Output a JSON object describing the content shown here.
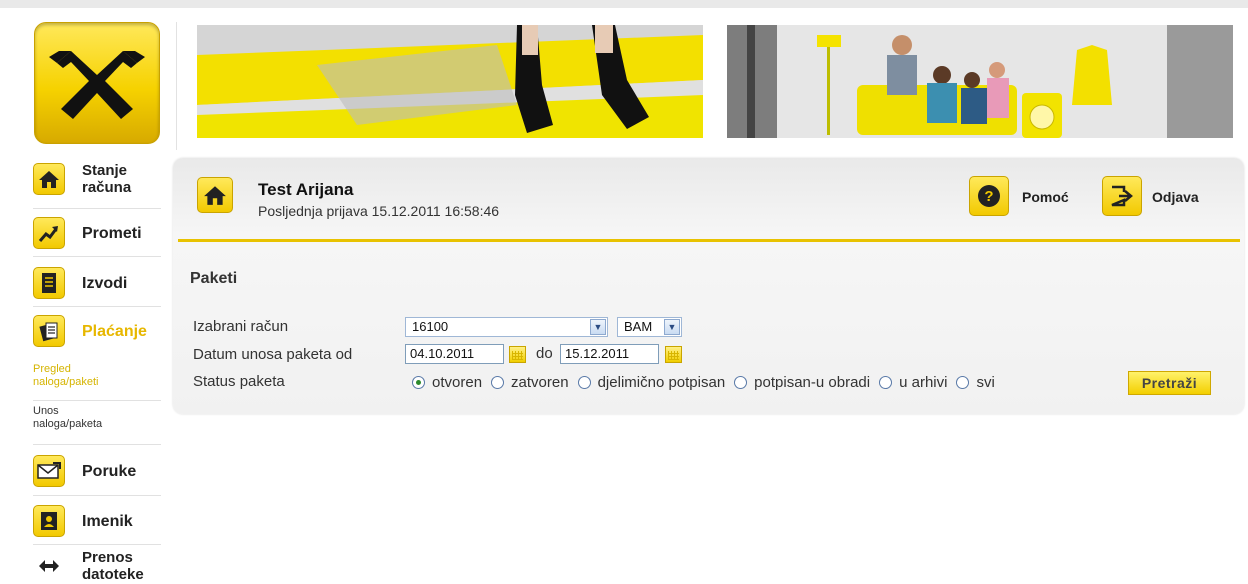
{
  "sidebar": {
    "items": [
      {
        "label": "Stanje računa",
        "line1": "Stanje",
        "line2": "računa"
      },
      {
        "label": "Prometi"
      },
      {
        "label": "Izvodi"
      },
      {
        "label": "Plaćanje"
      },
      {
        "label": "Poruke"
      },
      {
        "label": "Imenik"
      },
      {
        "label": "Prenos datoteke",
        "line1": "Prenos",
        "line2": "datoteke"
      }
    ],
    "subitems": [
      {
        "line1": "Pregled",
        "line2": "naloga/paketi"
      },
      {
        "line1": "Unos",
        "line2": "naloga/paketa"
      }
    ]
  },
  "header": {
    "user_name": "Test Arijana",
    "last_login": "Posljednja prijava 15.12.2011 16:58:46",
    "help_label": "Pomoć",
    "logout_label": "Odjava"
  },
  "main": {
    "section_title": "Paketi",
    "labels": {
      "account": "Izabrani račun",
      "date_from": "Datum unosa paketa od",
      "date_to": "do",
      "status": "Status paketa"
    },
    "account_select": "16100",
    "currency_select": "BAM",
    "date_from_value": "04.10.2011",
    "date_to_value": "15.12.2011",
    "status_options": [
      "otvoren",
      "zatvoren",
      "djelimično potpisan",
      "potpisan-u obradi",
      "u arhivi",
      "svi"
    ],
    "status_selected": "otvoren",
    "search_button": "Pretraži"
  },
  "colors": {
    "accent": "#f2c900",
    "accent_text": "#e7b700",
    "panel": "#f1f1f1"
  }
}
